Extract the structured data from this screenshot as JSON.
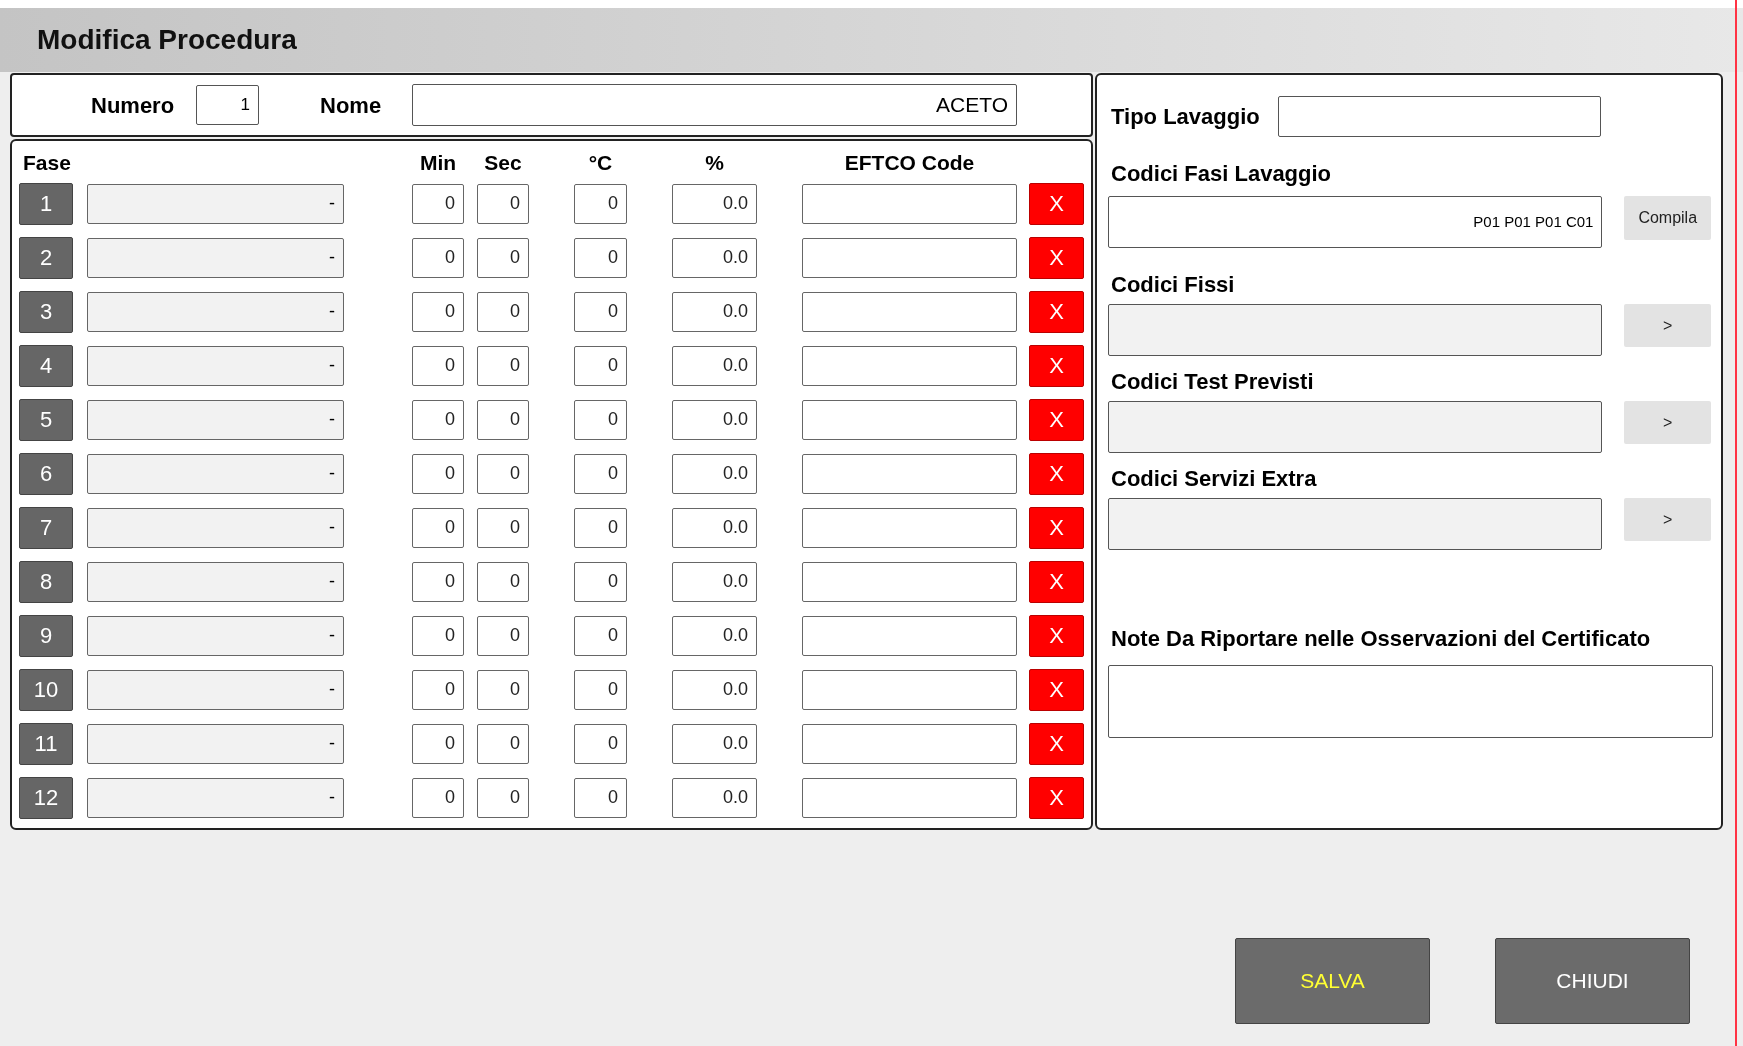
{
  "window": {
    "title": "Modifica Procedura"
  },
  "header": {
    "numero_label": "Numero",
    "numero": "1",
    "nome_label": "Nome",
    "nome": "ACETO"
  },
  "table": {
    "columns": [
      "Fase",
      "Min",
      "Sec",
      "°C",
      "%",
      "EFTCO Code"
    ],
    "rows": [
      {
        "fase": "1",
        "name": "-",
        "min": "0",
        "sec": "0",
        "temp": "0",
        "pct": "0.0",
        "delete": "X"
      },
      {
        "fase": "2",
        "name": "-",
        "min": "0",
        "sec": "0",
        "temp": "0",
        "pct": "0.0",
        "delete": "X"
      },
      {
        "fase": "3",
        "name": "-",
        "min": "0",
        "sec": "0",
        "temp": "0",
        "pct": "0.0",
        "delete": "X"
      },
      {
        "fase": "4",
        "name": "-",
        "min": "0",
        "sec": "0",
        "temp": "0",
        "pct": "0.0",
        "delete": "X"
      },
      {
        "fase": "5",
        "name": "-",
        "min": "0",
        "sec": "0",
        "temp": "0",
        "pct": "0.0",
        "delete": "X"
      },
      {
        "fase": "6",
        "name": "-",
        "min": "0",
        "sec": "0",
        "temp": "0",
        "pct": "0.0",
        "delete": "X"
      },
      {
        "fase": "7",
        "name": "-",
        "min": "0",
        "sec": "0",
        "temp": "0",
        "pct": "0.0",
        "delete": "X"
      },
      {
        "fase": "8",
        "name": "-",
        "min": "0",
        "sec": "0",
        "temp": "0",
        "pct": "0.0",
        "delete": "X"
      },
      {
        "fase": "9",
        "name": "-",
        "min": "0",
        "sec": "0",
        "temp": "0",
        "pct": "0.0",
        "delete": "X"
      },
      {
        "fase": "10",
        "name": "-",
        "min": "0",
        "sec": "0",
        "temp": "0",
        "pct": "0.0",
        "delete": "X"
      },
      {
        "fase": "11",
        "name": "-",
        "min": "0",
        "sec": "0",
        "temp": "0",
        "pct": "0.0",
        "delete": "X"
      },
      {
        "fase": "12",
        "name": "-",
        "min": "0",
        "sec": "0",
        "temp": "0",
        "pct": "0.0",
        "delete": "X"
      }
    ]
  },
  "side": {
    "tipo_label": "Tipo Lavaggio",
    "fasi_label": "Codici Fasi Lavaggio",
    "fasi_value": "P01 P01 P01 C01",
    "compila": "Compila",
    "code_fields": [
      {
        "label": "Codici Fissi",
        "button": ">"
      },
      {
        "label": "Codici Test Previsti",
        "button": ">"
      },
      {
        "label": "Codici Servizi Extra",
        "button": ">"
      }
    ],
    "note_label": "Note Da Riportare nelle Osservazioni del Certificato"
  },
  "buttons": [
    {
      "label": "SALVA",
      "kind": "primary"
    },
    {
      "label": "CHIUDI",
      "kind": "secondary"
    }
  ]
}
